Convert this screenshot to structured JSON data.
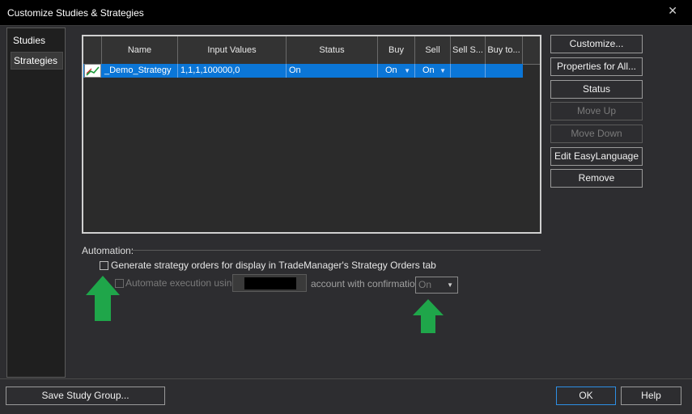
{
  "window": {
    "title": "Customize Studies & Strategies",
    "close_glyph": "✕"
  },
  "left_panel": {
    "items": [
      {
        "label": "Studies"
      },
      {
        "label": "Strategies"
      }
    ]
  },
  "grid": {
    "columns": [
      "",
      "Name",
      "Input Values",
      "Status",
      "Buy",
      "Sell",
      "Sell S...",
      "Buy to..."
    ],
    "rows": [
      {
        "icon": "strategy-chart-icon",
        "name": "_Demo_Strategy",
        "input_values": "1,1,1,100000,0",
        "status": "On",
        "buy": "On",
        "sell": "On",
        "sell_short": "",
        "buy_to_cover": ""
      }
    ]
  },
  "side_buttons": {
    "customize": "Customize...",
    "properties_for_all": "Properties for All...",
    "status": "Status",
    "move_up": "Move Up",
    "move_down": "Move Down",
    "edit_easylanguage": "Edit EasyLanguage",
    "remove": "Remove"
  },
  "automation": {
    "group_label": "Automation:",
    "generate_orders_label": "Generate strategy orders for display in TradeManager's Strategy Orders tab",
    "automate_label": "Automate execution using",
    "account_label": "account with confirmation",
    "confirmation_value": "On"
  },
  "bottom": {
    "save_study_group": "Save Study Group...",
    "ok": "OK",
    "help": "Help"
  },
  "colors": {
    "selection": "#0b76d7",
    "annotation_arrow": "#1fa64a",
    "background": "#2d2d30"
  }
}
